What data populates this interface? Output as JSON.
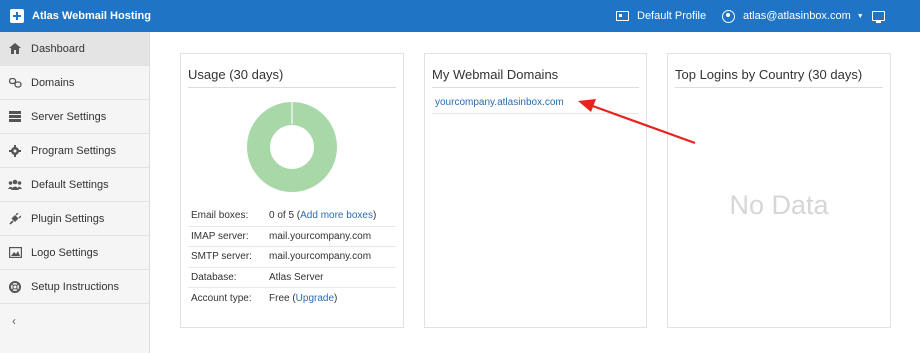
{
  "topbar": {
    "title": "Atlas Webmail Hosting",
    "profile_label": "Default Profile",
    "account_email": "atlas@atlasinbox.com",
    "brand_color": "#1f74c5"
  },
  "sidebar": {
    "items": [
      {
        "label": "Dashboard",
        "icon": "home-icon",
        "active": true
      },
      {
        "label": "Domains",
        "icon": "link-icon"
      },
      {
        "label": "Server Settings",
        "icon": "server-icon"
      },
      {
        "label": "Program Settings",
        "icon": "gear-icon"
      },
      {
        "label": "Default Settings",
        "icon": "users-icon"
      },
      {
        "label": "Plugin Settings",
        "icon": "plug-icon"
      },
      {
        "label": "Logo Settings",
        "icon": "image-icon"
      },
      {
        "label": "Setup Instructions",
        "icon": "lifebuoy-icon"
      }
    ],
    "collapse_glyph": "‹"
  },
  "usage": {
    "title": "Usage (30 days)",
    "donut_color": "#a8d8a8",
    "rows": [
      {
        "key": "Email boxes:",
        "value": "0 of 5 (",
        "link": "Add more boxes",
        "suffix": ")"
      },
      {
        "key": "IMAP server:",
        "value": "mail.yourcompany.com"
      },
      {
        "key": "SMTP server:",
        "value": "mail.yourcompany.com"
      },
      {
        "key": "Database:",
        "value": "Atlas Server"
      },
      {
        "key": "Account type:",
        "value": "Free (",
        "link": "Upgrade",
        "suffix": ")"
      }
    ]
  },
  "domains": {
    "title": "My Webmail Domains",
    "items": [
      "yourcompany.atlasinbox.com"
    ]
  },
  "logins": {
    "title": "Top Logins by Country (30 days)",
    "empty_text": "No Data"
  },
  "annotation": {
    "arrow_color": "#e8231d"
  }
}
